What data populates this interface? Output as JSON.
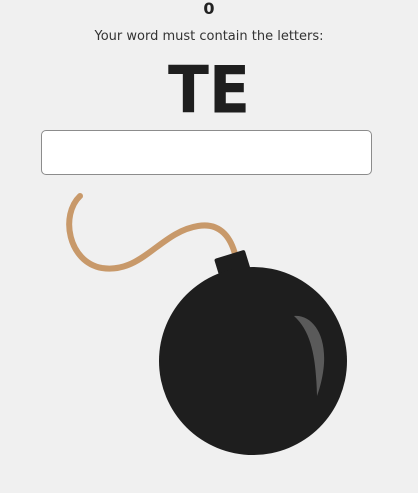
{
  "game": {
    "score": "0",
    "prompt": "Your word must contain the letters:",
    "letters": "TE",
    "input": {
      "value": "",
      "placeholder": ""
    }
  },
  "colors": {
    "background": "#f0f0f0",
    "bomb": "#1e1e1e",
    "fuse": "#c8996a",
    "highlight": "#5a5a5a"
  },
  "icons": {
    "bomb": "bomb-icon"
  }
}
